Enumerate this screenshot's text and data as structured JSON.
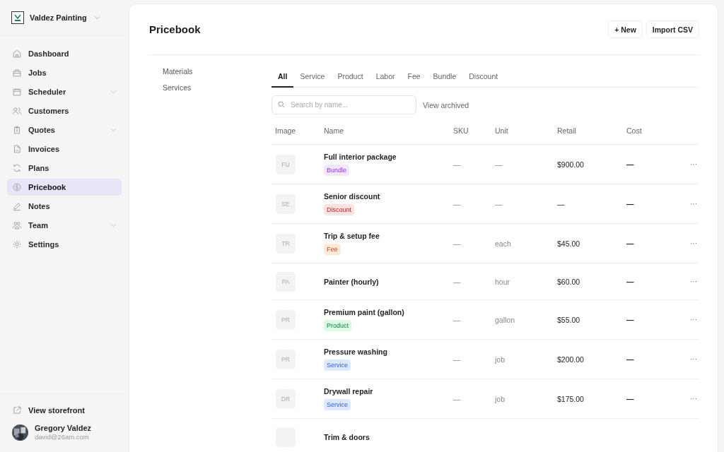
{
  "workspace": {
    "name": "Valdez Painting"
  },
  "sidebar": {
    "items": [
      {
        "label": "Dashboard",
        "selected": false,
        "expandable": false
      },
      {
        "label": "Jobs",
        "selected": false,
        "expandable": false
      },
      {
        "label": "Scheduler",
        "selected": false,
        "expandable": true
      },
      {
        "label": "Customers",
        "selected": false,
        "expandable": false
      },
      {
        "label": "Quotes",
        "selected": false,
        "expandable": true
      },
      {
        "label": "Invoices",
        "selected": false,
        "expandable": false
      },
      {
        "label": "Plans",
        "selected": false,
        "expandable": false
      },
      {
        "label": "Pricebook",
        "selected": true,
        "expandable": false
      },
      {
        "label": "Notes",
        "selected": false,
        "expandable": false
      },
      {
        "label": "Team",
        "selected": false,
        "expandable": true
      },
      {
        "label": "Settings",
        "selected": false,
        "expandable": false
      }
    ],
    "storefront": "View storefront",
    "user": {
      "name": "Gregory Valdez",
      "email": "david@26am.com"
    }
  },
  "page": {
    "title": "Pricebook",
    "buttons": [
      "+ New",
      "Import CSV"
    ]
  },
  "subnav": [
    "Materials",
    "Services"
  ],
  "tabs": [
    {
      "label": "All",
      "selected": true
    },
    {
      "label": "Service",
      "selected": false
    },
    {
      "label": "Product",
      "selected": false
    },
    {
      "label": "Labor",
      "selected": false
    },
    {
      "label": "Fee",
      "selected": false
    },
    {
      "label": "Bundle",
      "selected": false
    },
    {
      "label": "Discount",
      "selected": false
    }
  ],
  "search": {
    "placeholder": "Search by name..."
  },
  "view_archived": "View archived",
  "table": {
    "columns": [
      "Image",
      "Name",
      "SKU",
      "Unit",
      "Retail",
      "Cost"
    ],
    "rows": [
      {
        "initials": "FU",
        "name": "Full interior package",
        "tag": {
          "label": "Bundle",
          "kind": "bundle"
        },
        "sku": "—",
        "unit": "—",
        "retail": "$900.00",
        "cost": "—",
        "menu": "···"
      },
      {
        "initials": "SE",
        "name": "Senior discount",
        "tag": {
          "label": "Discount",
          "kind": "discount"
        },
        "sku": "—",
        "unit": "—",
        "retail": "—",
        "cost": "—",
        "menu": "···"
      },
      {
        "initials": "TR",
        "name": "Trip & setup fee",
        "tag": {
          "label": "Fee",
          "kind": "fee"
        },
        "sku": "—",
        "unit": "each",
        "retail": "$45.00",
        "cost": "—",
        "menu": "···"
      },
      {
        "initials": "PA",
        "name": "Painter (hourly)",
        "sku": "—",
        "unit": "hour",
        "retail": "$60.00",
        "cost": "—",
        "menu": "···"
      },
      {
        "initials": "PR",
        "name": "Premium paint (gallon)",
        "tag": {
          "label": "Product",
          "kind": "product"
        },
        "sku": "—",
        "unit": "gallon",
        "retail": "$55.00",
        "cost": "—",
        "menu": "···"
      },
      {
        "initials": "PR",
        "name": "Pressure washing",
        "tag": {
          "label": "Service",
          "kind": "service"
        },
        "sku": "—",
        "unit": "job",
        "retail": "$200.00",
        "cost": "—",
        "menu": "···"
      },
      {
        "initials": "DR",
        "name": "Drywall repair",
        "tag": {
          "label": "Service",
          "kind": "service"
        },
        "sku": "—",
        "unit": "job",
        "retail": "$175.00",
        "cost": "—",
        "menu": "···"
      },
      {
        "name": "Trim & doors"
      }
    ]
  }
}
